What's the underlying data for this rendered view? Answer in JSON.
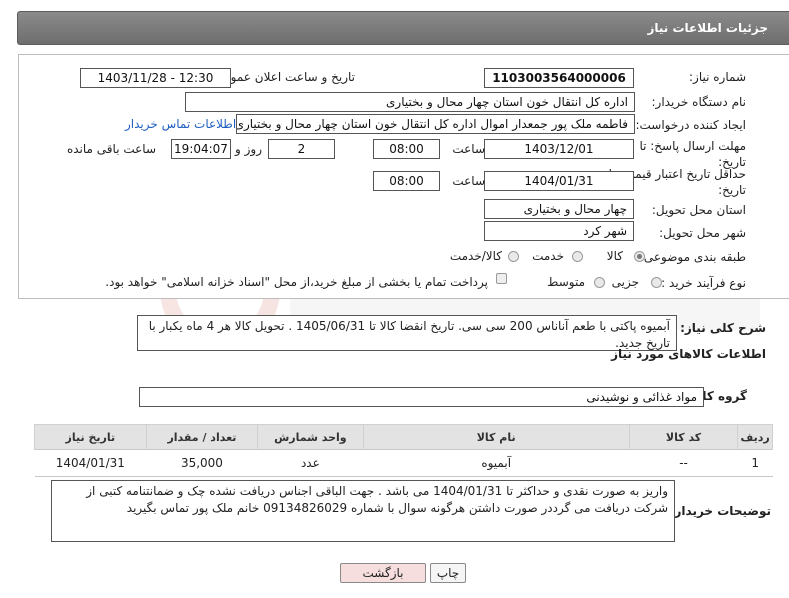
{
  "header": {
    "title": "جزئیات اطلاعات نیاز"
  },
  "form": {
    "need_number_label": "شماره نیاز:",
    "need_number": "1103003564000006",
    "announce_label": "تاریخ و ساعت اعلان عمومی:",
    "announce_value": "1403/11/28 - 12:30",
    "buyer_label": "نام دستگاه خریدار:",
    "buyer_value": "اداره کل انتقال خون استان چهار محال و بختیاری",
    "requester_label": "ایجاد کننده درخواست:",
    "requester_value": "فاطمه ملک پور جمعدار اموال اداره کل انتقال خون استان چهار محال و بختیاری",
    "contact_link": "اطلاعات تماس خریدار",
    "send_deadline_label": "مهلت ارسال پاسخ: تا تاریخ:",
    "send_date": "1403/12/01",
    "time_label": "ساعت",
    "send_time": "08:00",
    "days_value": "2",
    "days_label": "روز و",
    "remaining_time": "19:04:07",
    "remaining_label": "ساعت باقی مانده",
    "min_validity_label": "حداقل تاریخ اعتبار قیمت: تا تاریخ:",
    "validity_date": "1404/01/31",
    "time_label_2": "ساعت",
    "validity_time": "08:00",
    "province_label": "استان محل تحویل:",
    "province_value": "چهار محال و بختیاری",
    "city_label": "شهر محل تحویل:",
    "city_value": "شهر کرد",
    "category_label": "طبقه بندی موضوعی:",
    "category_options": [
      "کالا",
      "خدمت",
      "کالا/خدمت"
    ],
    "process_label": "نوع فرآیند خرید :",
    "process_options": [
      "جزیی",
      "متوسط"
    ],
    "payment_note": "پرداخت تمام یا بخشی از مبلغ خرید،از محل \"اسناد خزانه اسلامی\" خواهد بود."
  },
  "general_desc": {
    "label": "شرح کلی نیاز:",
    "text": "آبمیوه پاکتی با طعم آناناس 200 سی سی. تاریخ انقضا کالا تا 1405/06/31 . تحویل کالا هر 4 ماه یکبار با تاریخ جدید."
  },
  "goods_info": {
    "heading": "اطلاعات کالاهای مورد نیاز",
    "group_label": "گروه کالا:",
    "group_value": "مواد غذائی و نوشیدنی"
  },
  "table": {
    "headers": [
      "ردیف",
      "کد کالا",
      "نام کالا",
      "واحد شمارش",
      "تعداد / مقدار",
      "تاریخ نیاز"
    ],
    "rows": [
      [
        "1",
        "--",
        "آبمیوه",
        "عدد",
        "35,000",
        "1404/01/31"
      ]
    ]
  },
  "buyer_desc": {
    "label": "توضیحات خریدار:",
    "text": "واریز به صورت نقدی و حداکثر تا 1404/01/31 می باشد . جهت الباقی اجناس دریافت نشده چک و ضمانتنامه کتبی از شرکت دریافت می گرددر صورت داشتن هرگونه سوال با شماره 09134826029 خانم ملک پور تماس بگیرید"
  },
  "buttons": {
    "print": "چاپ",
    "back": "بازگشت"
  },
  "colors": {
    "link": "#1f5fbf",
    "back_button_bg": "#f6dede",
    "header_bg": "#7a7a7a"
  }
}
